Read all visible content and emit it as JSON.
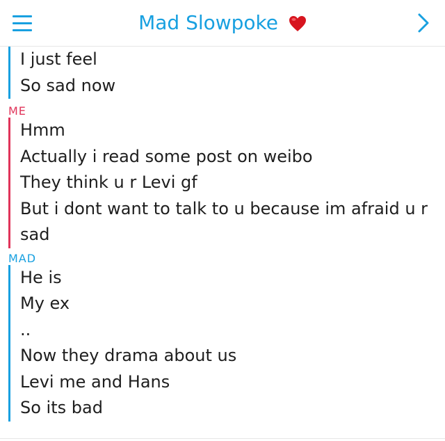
{
  "header": {
    "title": "Mad Slowpoke",
    "menu_icon": "hamburger-menu-icon",
    "heart_icon": "red-heart-icon",
    "chevron_icon": "chevron-right-icon",
    "accent_color": "#18a0e0"
  },
  "conversation": {
    "continued_group": {
      "messages": [
        "I just feel",
        "So sad now"
      ]
    },
    "me_group": {
      "sender": "ME",
      "color": "#e0345a",
      "messages": [
        "Hmm",
        "Actually i read some post on weibo",
        "They think u r Levi gf",
        "But i dont want to talk to u because im afraid u r",
        "sad"
      ]
    },
    "mad_group": {
      "sender": "MAD",
      "color": "#18a0e0",
      "messages": [
        "He is",
        "My ex",
        "..",
        "Now they drama about us",
        "Levi me and Hans",
        "So its bad"
      ]
    }
  }
}
